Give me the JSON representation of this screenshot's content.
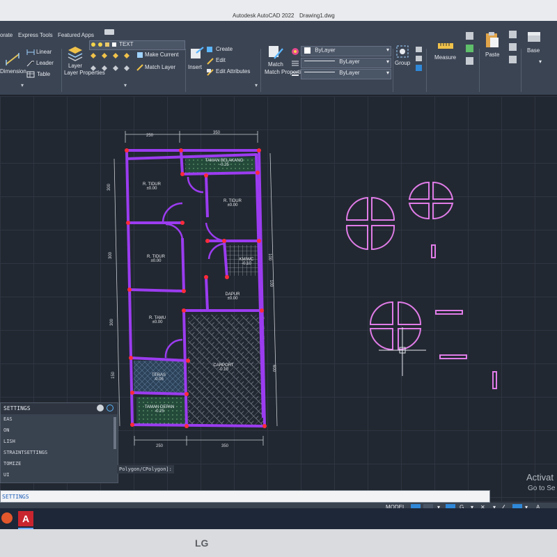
{
  "window": {
    "title": "Autodesk AutoCAD 2022",
    "filename": "Drawing1.dwg"
  },
  "ribbon": {
    "tabs": [
      "orate",
      "Express Tools",
      "Featured Apps"
    ],
    "annotation": {
      "dimension": "Dimension",
      "linear": "Linear",
      "leader": "Leader",
      "table": "Table"
    },
    "layers": {
      "layer_properties": "Layer Properties",
      "layer_name": "TEXT",
      "make_current": "Make Current",
      "match_layer": "Match Layer"
    },
    "block": {
      "insert": "Insert",
      "create": "Create",
      "edit": "Edit",
      "edit_attributes": "Edit Attributes"
    },
    "properties": {
      "match_properties": "Match Properties",
      "color": "ByLayer",
      "linetype": "ByLayer",
      "lineweight": "ByLayer"
    },
    "groups": {
      "group": "Group"
    },
    "utilities": {
      "measure": "Measure"
    },
    "clipboard": {
      "paste": "Paste"
    },
    "view": {
      "base": "Base"
    }
  },
  "plan": {
    "top_dims": [
      "250",
      "350"
    ],
    "bottom_dims": [
      "250",
      "350"
    ],
    "left_dims": [
      "300",
      "300",
      "300",
      "150",
      "150"
    ],
    "right_dims": [
      "100",
      "100",
      "600"
    ],
    "rooms": [
      {
        "name": "TAMAN BELAKANG",
        "level": "-0.25"
      },
      {
        "name": "R. TIDUR",
        "level": "±0.00"
      },
      {
        "name": "R. TIDUR",
        "level": "±0.00"
      },
      {
        "name": "R. TIDUR",
        "level": "±0.00"
      },
      {
        "name": "KM/WC",
        "level": "-0.10"
      },
      {
        "name": "DAPUR",
        "level": "±0.00"
      },
      {
        "name": "R. TAMU",
        "level": "±0.00"
      },
      {
        "name": "CARPORT",
        "level": "-0.10"
      },
      {
        "name": "TERAS",
        "level": "-0.05"
      },
      {
        "name": "TAMAN DEPAN",
        "level": "-0.25"
      }
    ]
  },
  "command": {
    "header": "SETTINGS",
    "suggestions": [
      "EAS",
      "ON",
      "LISH",
      "STRAINTSETTINGS",
      "TOMIZE",
      "UI"
    ],
    "echo": "Polygon/CPolygon]:",
    "input": "SETTINGS"
  },
  "statusbar": {
    "model": "MODEL"
  },
  "watermark": {
    "line1": "Activat",
    "line2": "Go to Se"
  },
  "bezel": {
    "brand": "LG"
  },
  "colors": {
    "wall": "#9b3cf0",
    "node": "#ff2a3a",
    "fixture": "#e07ce8",
    "background": "#222831"
  }
}
